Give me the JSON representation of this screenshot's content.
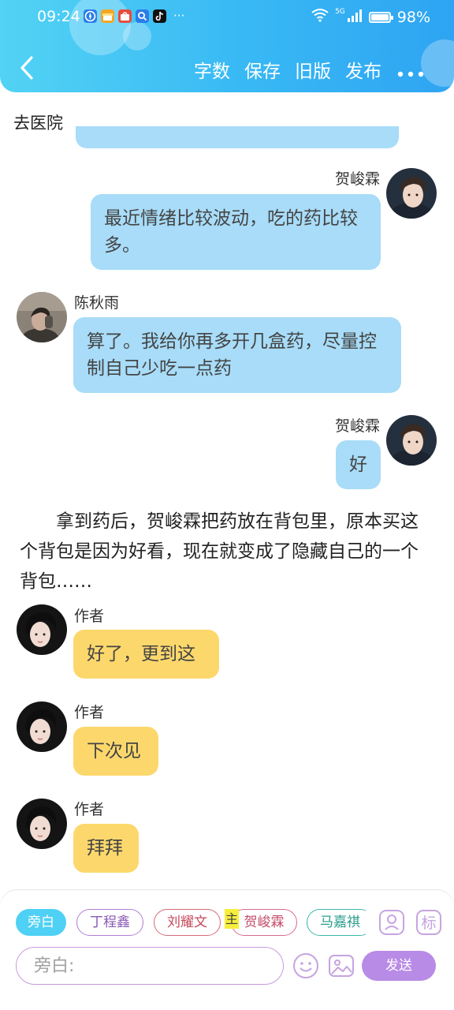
{
  "status_bar": {
    "time": "09:24",
    "app_icons": [
      "compass-app-icon",
      "gift-app-icon",
      "shop-app-icon",
      "search-app-icon",
      "tiktok-app-icon"
    ],
    "more": "···",
    "network_tag": "5G",
    "battery": "98%",
    "battery_level": 0.98
  },
  "header": {
    "actions": [
      "字数",
      "保存",
      "旧版",
      "发布"
    ]
  },
  "narration_top": "去医院",
  "messages": [
    {
      "side": "right",
      "name": "贺峻霖",
      "text": "最近情绪比较波动，吃的药比较多。",
      "color": "blue"
    },
    {
      "side": "left",
      "name": "陈秋雨",
      "text": "算了。我给你再多开几盒药，尽量控制自己少吃一点药",
      "color": "blue"
    },
    {
      "side": "right",
      "name": "贺峻霖",
      "text": "好",
      "color": "blue"
    }
  ],
  "narration": "拿到药后，贺峻霖把药放在背包里，原本买这个背包是因为好看，现在就变成了隐藏自己的一个背包……",
  "author_messages": [
    {
      "name": "作者",
      "text": "好了，更到这"
    },
    {
      "name": "作者",
      "text": "下次见"
    },
    {
      "name": "作者",
      "text": "拜拜"
    }
  ],
  "composer": {
    "chips": [
      "旁白",
      "丁程鑫",
      "刘耀文",
      "贺峻霖",
      "马嘉祺"
    ],
    "main_tag": "主",
    "placeholder": "旁白:",
    "send_label": "发送",
    "mark_label": "标"
  },
  "colors": {
    "header_start": "#52d3f4",
    "header_end": "#2ea4f2",
    "bubble_blue": "#a8dcf8",
    "bubble_yellow": "#fcd86c",
    "send": "#b88be6"
  }
}
